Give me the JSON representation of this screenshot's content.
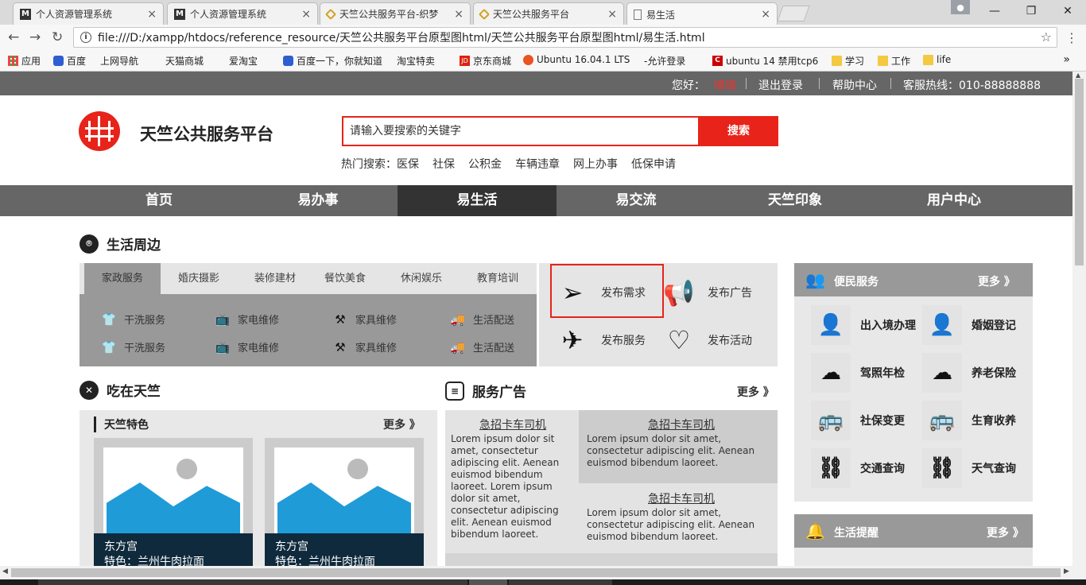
{
  "browser": {
    "tabs": [
      {
        "icon": "M",
        "title": "个人资源管理系统"
      },
      {
        "icon": "M",
        "title": "个人资源管理系统"
      },
      {
        "icon": "",
        "title": "天竺公共服务平台-织梦"
      },
      {
        "icon": "",
        "title": "天竺公共服务平台"
      },
      {
        "icon": "",
        "title": "易生活"
      }
    ],
    "url": "file:///D:/xampp/htdocs/reference_resource/天竺公共服务平台原型图html/天竺公共服务平台原型图html/易生活.html",
    "bookmarks": [
      "应用",
      "百度",
      "上网导航",
      "天猫商城",
      "爱淘宝",
      "百度一下，你就知道",
      "淘宝特卖",
      "京东商城",
      "Ubuntu 16.04.1 LTS",
      "-允许登录",
      "ubuntu 14 禁用tcp6",
      "学习",
      "工作",
      "life"
    ],
    "bookmark_more": "»"
  },
  "topbar": {
    "greeting": "您好：",
    "username": "嘻嘻",
    "logout": "退出登录",
    "help": "帮助中心",
    "hotline": "客服热线：010-88888888"
  },
  "header": {
    "title": "天竺公共服务平台",
    "search_placeholder": "请输入要搜索的关键字",
    "search_button": "搜索",
    "hot_label": "热门搜索：",
    "hot_items": [
      "医保",
      "社保",
      "公积金",
      "车辆违章",
      "网上办事",
      "低保申请"
    ]
  },
  "nav": [
    "首页",
    "易办事",
    "易生活",
    "易交流",
    "天竺印象",
    "用户中心"
  ],
  "life": {
    "title": "生活周边",
    "tabs": [
      "家政服务",
      "婚庆摄影",
      "装修建材",
      "餐饮美食",
      "休闲娱乐",
      "教育培训"
    ],
    "items": [
      "干洗服务",
      "家电维修",
      "家具维修",
      "生活配送",
      "干洗服务",
      "家电维修",
      "家具维修",
      "生活配送"
    ]
  },
  "publish": [
    "发布需求",
    "发布广告",
    "发布服务",
    "发布活动"
  ],
  "eat": {
    "title": "吃在天竺",
    "sub": "天竺特色",
    "more": "更多 》",
    "cards": [
      {
        "name": "东方宫",
        "desc": "特色：兰州牛肉拉面"
      },
      {
        "name": "东方宫",
        "desc": "特色：兰州牛肉拉面"
      }
    ]
  },
  "ads": {
    "title": "服务广告",
    "more": "更多 》",
    "items": [
      {
        "title": "急招卡车司机",
        "body": "Lorem ipsum dolor sit amet, consectetur adipiscing elit. Aenean euismod bibendum laoreet. Lorem ipsum dolor sit amet, consectetur adipiscing elit. Aenean euismod bibendum laoreet."
      },
      {
        "title": "急招卡车司机",
        "body": "Lorem ipsum dolor sit amet, consectetur adipiscing elit. Aenean euismod bibendum laoreet."
      },
      {
        "title": "急招卡车司机",
        "body": "Lorem ipsum dolor sit amet, consectetur adipiscing elit. Aenean euismod bibendum laoreet."
      }
    ]
  },
  "services": {
    "title": "便民服务",
    "more": "更多 》",
    "items": [
      "出入境办理",
      "婚姻登记",
      "驾照年检",
      "养老保险",
      "社保变更",
      "生育收养",
      "交通查询",
      "天气查询"
    ]
  },
  "reminder": {
    "title": "生活提醒",
    "more": "更多 》"
  },
  "colors": {
    "brand_red": "#e8231a",
    "nav_gray": "#666666",
    "nav_active": "#333333"
  }
}
